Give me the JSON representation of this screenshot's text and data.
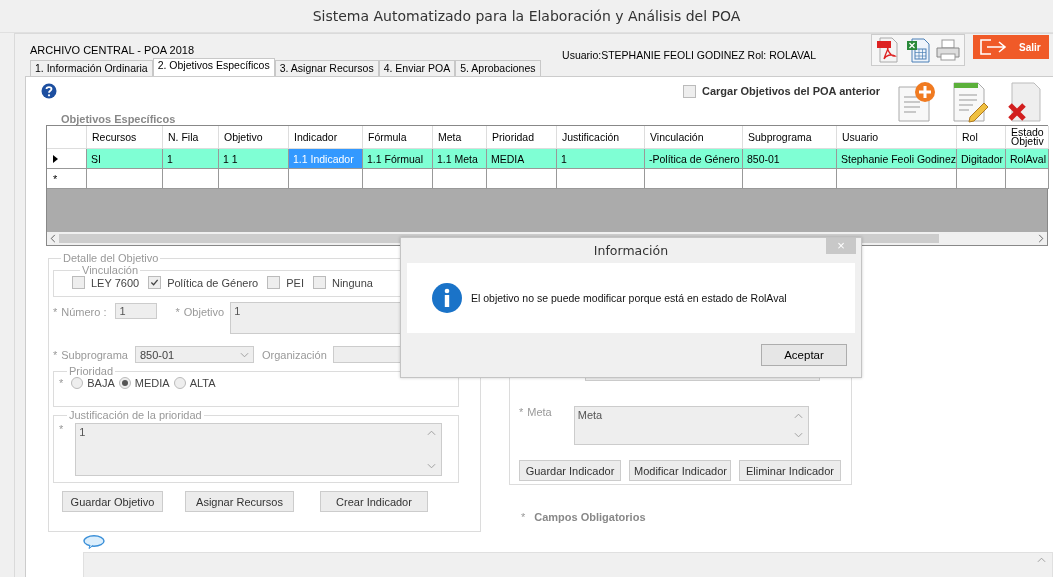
{
  "window": {
    "title": "Sistema Automatizado para la Elaboración y Análisis del POA"
  },
  "header": {
    "archive": "ARCHIVO CENTRAL - POA 2018",
    "user": "Usuario:STEPHANIE FEOLI GODINEZ  Rol: ROLAVAL",
    "exit_button": "Salir"
  },
  "tabs": [
    {
      "label": "1. Información Ordinaria",
      "selected": false
    },
    {
      "label": "2. Objetivos Específicos",
      "selected": true
    },
    {
      "label": "3. Asignar Recursos",
      "selected": false
    },
    {
      "label": "4. Enviar POA",
      "selected": false
    },
    {
      "label": "5. Aprobaciones",
      "selected": false
    }
  ],
  "load_previous": {
    "label": "Cargar Objetivos del POA anterior",
    "checked": false
  },
  "grid": {
    "title": "Objetivos Específicos",
    "columns": [
      "Recursos",
      "N. Fila",
      "Objetivo",
      "Indicador",
      "Fórmula",
      "Meta",
      "Prioridad",
      "Justificación",
      "Vinculación",
      "Subprograma",
      "Usuario",
      "Rol",
      "Estado Objetiv"
    ],
    "rows": [
      {
        "selected": true,
        "cells": [
          {
            "text": "SI",
            "current": false
          },
          {
            "text": "1",
            "current": false
          },
          {
            "text": "1 1",
            "current": false
          },
          {
            "text": "1.1 Indicador",
            "current": true
          },
          {
            "text": "1.1 Fórmual",
            "current": false
          },
          {
            "text": "1.1 Meta",
            "current": false
          },
          {
            "text": "MEDIA",
            "current": false
          },
          {
            "text": "1",
            "current": false
          },
          {
            "text": "-Política de Género",
            "current": false
          },
          {
            "text": "850-01",
            "current": false
          },
          {
            "text": "Stephanie Feoli Godinez",
            "current": false
          },
          {
            "text": "Digitador",
            "current": false
          },
          {
            "text": "RolAval",
            "current": false
          }
        ]
      }
    ],
    "new_row_marker": "*"
  },
  "detail": {
    "title": "Detalle del Objetivo",
    "vinculacion": {
      "title": "Vinculación",
      "options": [
        {
          "label": "LEY 7600",
          "checked": false
        },
        {
          "label": "Política de Género",
          "checked": true
        },
        {
          "label": "PEI",
          "checked": false
        },
        {
          "label": "Ninguna",
          "checked": false
        }
      ]
    },
    "numero": {
      "mark": "*",
      "label": "Número :",
      "value": "1"
    },
    "objetivo": {
      "mark": "*",
      "label": "Objetivo",
      "value": "1"
    },
    "subprograma": {
      "mark": "*",
      "label": "Subprograma",
      "value": "850-01"
    },
    "organizacion": {
      "label": "Organización"
    },
    "prioridad": {
      "title": "Prioridad",
      "mark": "*",
      "options": [
        {
          "label": "BAJA",
          "selected": false
        },
        {
          "label": "MEDIA",
          "selected": true
        },
        {
          "label": "ALTA",
          "selected": false
        }
      ]
    },
    "justificacion": {
      "title": "Justificación de la prioridad",
      "mark": "*",
      "value": "1"
    },
    "buttons": [
      "Guardar Objetivo",
      "Asignar Recursos",
      "Crear Indicador"
    ]
  },
  "indicator": {
    "meta": {
      "mark": "*",
      "label": "Meta",
      "value": "Meta"
    },
    "buttons": [
      "Guardar Indicador",
      "Modificar Indicador",
      "Eliminar Indicador"
    ]
  },
  "required_note": {
    "mark": "*",
    "text": "Campos Obligatorios"
  },
  "dialog": {
    "title": "Información",
    "close": "×",
    "message": "El objetivo no se puede modificar porque está en estado de RolAval",
    "button": "Aceptar"
  }
}
